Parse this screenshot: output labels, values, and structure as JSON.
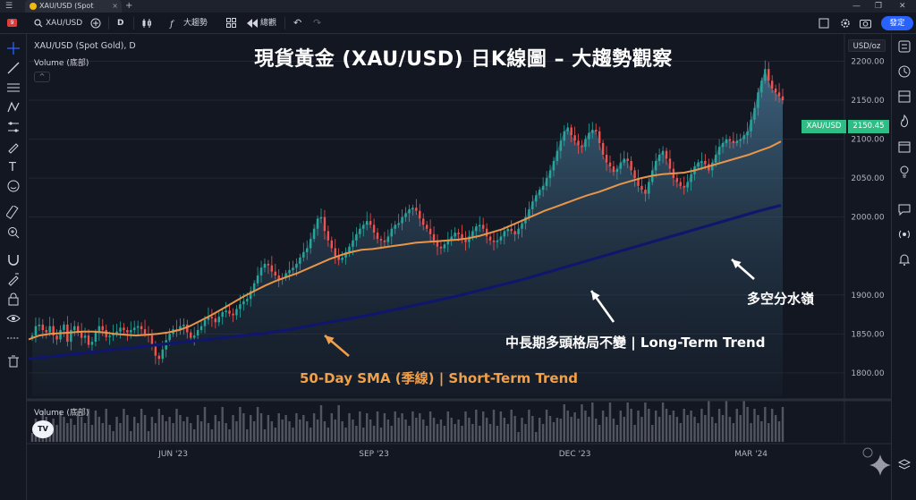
{
  "browser": {
    "tab_title": "XAU/USD (Spot",
    "tab_close": "×",
    "new_tab": "+",
    "menu_glyph": "☰",
    "win_min": "—",
    "win_max": "❐",
    "win_close": "✕"
  },
  "toolbar": {
    "notif_count": "9",
    "symbol": "XAU/USD",
    "interval": "D",
    "indicators": "大趨勢",
    "replay": "總觀",
    "undo": "↶",
    "redo": "↷",
    "publish": "發定"
  },
  "legend": {
    "symbol": "XAU/USD (Spot Gold), D",
    "volume": "Volume (底部)"
  },
  "overlay": {
    "title": "現貨黃金 (XAU/USD) 日K線圖 – 大趨勢觀察",
    "sma_label": "50-Day SMA (季線) | Short-Term Trend",
    "longterm_label": "中長期多頭格局不變 | Long-Term Trend",
    "watershed_label": "多空分水嶺"
  },
  "price_axis": {
    "unit": "USD/oz",
    "ticks": [
      "2200.00",
      "2150.00",
      "2100.00",
      "2050.00",
      "2000.00",
      "1900.00",
      "1850.00",
      "1800.00"
    ]
  },
  "last_price": {
    "symbol": "XAU/USD",
    "value": "2150.45"
  },
  "time_axis": {
    "labels": [
      "JUN '23",
      "SEP '23",
      "DEC '23",
      "MAR '24"
    ]
  },
  "volume_legend": "Volume (底部)",
  "logo": "TV",
  "colors": {
    "bg": "#131722",
    "up": "#26a69a",
    "down": "#ef5350",
    "sma50": "#f0a04b",
    "longterm": "#1a237e",
    "area": "#3d6a8a",
    "label_bg": "#2ebd85"
  },
  "chart_data": {
    "type": "line",
    "title": "現貨黃金 (XAU/USD) 日K線圖 – 大趨勢觀察",
    "xlabel": "",
    "ylabel": "USD/oz",
    "x_labels": [
      "JUN '23",
      "SEP '23",
      "DEC '23",
      "MAR '24"
    ],
    "ylim": [
      1770,
      2235
    ],
    "grid": true,
    "y_ticks": [
      1800,
      1850,
      1900,
      2000,
      2050,
      2100,
      2150,
      2200
    ],
    "series": [
      {
        "name": "XAU/USD (Spot Gold), D",
        "kind": "price",
        "values": [
          1848,
          1860,
          1862,
          1855,
          1852,
          1860,
          1848,
          1843,
          1855,
          1862,
          1840,
          1855,
          1860,
          1852,
          1845,
          1848,
          1836,
          1840,
          1852,
          1860,
          1855,
          1846,
          1848,
          1850,
          1853,
          1858,
          1855,
          1852,
          1855,
          1858,
          1860,
          1856,
          1850,
          1848,
          1835,
          1822,
          1818,
          1830,
          1842,
          1850,
          1856,
          1855,
          1860,
          1862,
          1852,
          1845,
          1848,
          1855,
          1860,
          1868,
          1872,
          1870,
          1865,
          1872,
          1878,
          1880,
          1876,
          1874,
          1882,
          1888,
          1892,
          1895,
          1905,
          1915,
          1925,
          1935,
          1940,
          1938,
          1930,
          1925,
          1920,
          1922,
          1928,
          1932,
          1935,
          1940,
          1948,
          1955,
          1960,
          1972,
          1985,
          1998,
          2000,
          1982,
          1970,
          1960,
          1950,
          1945,
          1948,
          1955,
          1962,
          1970,
          1978,
          1985,
          1990,
          1995,
          1990,
          1980,
          1972,
          1970,
          1968,
          1975,
          1985,
          1990,
          1992,
          2000,
          2005,
          2010,
          2012,
          2008,
          1998,
          1990,
          1985,
          1978,
          1970,
          1962,
          1960,
          1965,
          1970,
          1975,
          1980,
          1978,
          1972,
          1968,
          1975,
          1982,
          1988,
          1990,
          1985,
          1975,
          1970,
          1968,
          1970,
          1975,
          1982,
          1985,
          1982,
          1978,
          1985,
          1992,
          2000,
          2010,
          2020,
          2028,
          2035,
          2040,
          2050,
          2060,
          2072,
          2085,
          2098,
          2110,
          2115,
          2105,
          2098,
          2092,
          2090,
          2100,
          2108,
          2112,
          2110,
          2095,
          2080,
          2070,
          2065,
          2058,
          2062,
          2070,
          2075,
          2072,
          2060,
          2050,
          2040,
          2035,
          2030,
          2045,
          2060,
          2072,
          2080,
          2085,
          2075,
          2062,
          2050,
          2045,
          2040,
          2038,
          2045,
          2055,
          2065,
          2070,
          2072,
          2068,
          2060,
          2070,
          2080,
          2090,
          2095,
          2100,
          2098,
          2095,
          2098,
          2100,
          2105,
          2110,
          2125,
          2140,
          2160,
          2175,
          2190,
          2175,
          2165,
          2160,
          2155,
          2150
        ]
      },
      {
        "name": "50-Day SMA (季線)",
        "kind": "sma",
        "values": [
          1843,
          1848,
          1850,
          1851,
          1852,
          1853,
          1853,
          1852,
          1850,
          1849,
          1848,
          1849,
          1850,
          1852,
          1855,
          1860,
          1867,
          1874,
          1882,
          1890,
          1898,
          1905,
          1912,
          1918,
          1923,
          1928,
          1934,
          1940,
          1946,
          1951,
          1955,
          1958,
          1959,
          1961,
          1963,
          1965,
          1967,
          1968,
          1969,
          1970,
          1971,
          1973,
          1976,
          1980,
          1984,
          1990,
          1996,
          2002,
          2008,
          2013,
          2018,
          2023,
          2028,
          2032,
          2037,
          2042,
          2046,
          2050,
          2053,
          2055,
          2056,
          2057,
          2060,
          2064,
          2068,
          2072,
          2076,
          2080,
          2085,
          2090,
          2097
        ]
      },
      {
        "name": "Long-Term Trend",
        "kind": "trend",
        "values": [
          1818,
          1821,
          1824,
          1827,
          1830,
          1833,
          1836,
          1839,
          1842,
          1845,
          1848,
          1851,
          1855,
          1860,
          1865,
          1870,
          1875,
          1881,
          1887,
          1893,
          1899,
          1906,
          1913,
          1920,
          1928,
          1936,
          1944,
          1952,
          1960,
          1968,
          1976,
          1984,
          1992,
          2000,
          2008,
          2015
        ]
      }
    ]
  }
}
